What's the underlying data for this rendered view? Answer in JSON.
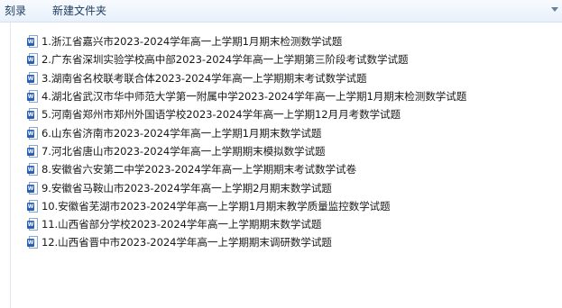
{
  "toolbar": {
    "burn_label": "刻录",
    "new_folder_label": "新建文件夹"
  },
  "files": [
    {
      "name": "1.浙江省嘉兴市2023-2024学年高一上学期1月期末检测数学试题",
      "icon": "word-doc-icon"
    },
    {
      "name": "2.广东省深圳实验学校高中部2023-2024学年高一上学期第三阶段考试数学试题",
      "icon": "word-doc-icon"
    },
    {
      "name": "3.湖南省名校联考联合体2023-2024学年高一上学期期末考试数学试题",
      "icon": "word-doc-icon"
    },
    {
      "name": "4.湖北省武汉市华中师范大学第一附属中学2023-2024学年高一上学期1月期末检测数学试题",
      "icon": "word-doc-icon"
    },
    {
      "name": "5.河南省郑州市郑州外国语学校2023-2024学年高一上学期12月月考数学试题",
      "icon": "word-doc-icon"
    },
    {
      "name": "6.山东省济南市2023-2024学年高一上学期1月期末数学试题",
      "icon": "word-doc-icon"
    },
    {
      "name": "7.河北省唐山市2023-2024学年高一上学期期末模拟数学试题",
      "icon": "word-doc-icon"
    },
    {
      "name": "8.安徽省六安第二中学2023-2024学年高一上学期期末考试数学试卷",
      "icon": "word-doc-icon"
    },
    {
      "name": "9.安徽省马鞍山市2023-2024学年高一上学期2月期末数学试题",
      "icon": "word-doc-icon"
    },
    {
      "name": "10.安徽省芜湖市2023-2024学年高一上学期1月期末教学质量监控数学试题",
      "icon": "word-doc-icon"
    },
    {
      "name": "11.山西省部分学校2023-2024学年高一上学期期末数学试题",
      "icon": "word-doc-icon"
    },
    {
      "name": "12.山西省晋中市2023-2024学年高一上学期期末调研数学试题",
      "icon": "word-doc-icon"
    }
  ]
}
